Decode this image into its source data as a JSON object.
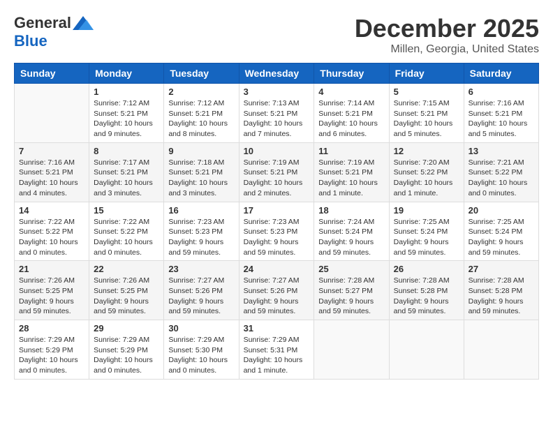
{
  "header": {
    "logo_general": "General",
    "logo_blue": "Blue",
    "month_title": "December 2025",
    "location": "Millen, Georgia, United States"
  },
  "weekdays": [
    "Sunday",
    "Monday",
    "Tuesday",
    "Wednesday",
    "Thursday",
    "Friday",
    "Saturday"
  ],
  "weeks": [
    [
      {
        "day": "",
        "info": ""
      },
      {
        "day": "1",
        "info": "Sunrise: 7:12 AM\nSunset: 5:21 PM\nDaylight: 10 hours\nand 9 minutes."
      },
      {
        "day": "2",
        "info": "Sunrise: 7:12 AM\nSunset: 5:21 PM\nDaylight: 10 hours\nand 8 minutes."
      },
      {
        "day": "3",
        "info": "Sunrise: 7:13 AM\nSunset: 5:21 PM\nDaylight: 10 hours\nand 7 minutes."
      },
      {
        "day": "4",
        "info": "Sunrise: 7:14 AM\nSunset: 5:21 PM\nDaylight: 10 hours\nand 6 minutes."
      },
      {
        "day": "5",
        "info": "Sunrise: 7:15 AM\nSunset: 5:21 PM\nDaylight: 10 hours\nand 5 minutes."
      },
      {
        "day": "6",
        "info": "Sunrise: 7:16 AM\nSunset: 5:21 PM\nDaylight: 10 hours\nand 5 minutes."
      }
    ],
    [
      {
        "day": "7",
        "info": "Sunrise: 7:16 AM\nSunset: 5:21 PM\nDaylight: 10 hours\nand 4 minutes."
      },
      {
        "day": "8",
        "info": "Sunrise: 7:17 AM\nSunset: 5:21 PM\nDaylight: 10 hours\nand 3 minutes."
      },
      {
        "day": "9",
        "info": "Sunrise: 7:18 AM\nSunset: 5:21 PM\nDaylight: 10 hours\nand 3 minutes."
      },
      {
        "day": "10",
        "info": "Sunrise: 7:19 AM\nSunset: 5:21 PM\nDaylight: 10 hours\nand 2 minutes."
      },
      {
        "day": "11",
        "info": "Sunrise: 7:19 AM\nSunset: 5:21 PM\nDaylight: 10 hours\nand 1 minute."
      },
      {
        "day": "12",
        "info": "Sunrise: 7:20 AM\nSunset: 5:22 PM\nDaylight: 10 hours\nand 1 minute."
      },
      {
        "day": "13",
        "info": "Sunrise: 7:21 AM\nSunset: 5:22 PM\nDaylight: 10 hours\nand 0 minutes."
      }
    ],
    [
      {
        "day": "14",
        "info": "Sunrise: 7:22 AM\nSunset: 5:22 PM\nDaylight: 10 hours\nand 0 minutes."
      },
      {
        "day": "15",
        "info": "Sunrise: 7:22 AM\nSunset: 5:22 PM\nDaylight: 10 hours\nand 0 minutes."
      },
      {
        "day": "16",
        "info": "Sunrise: 7:23 AM\nSunset: 5:23 PM\nDaylight: 9 hours\nand 59 minutes."
      },
      {
        "day": "17",
        "info": "Sunrise: 7:23 AM\nSunset: 5:23 PM\nDaylight: 9 hours\nand 59 minutes."
      },
      {
        "day": "18",
        "info": "Sunrise: 7:24 AM\nSunset: 5:24 PM\nDaylight: 9 hours\nand 59 minutes."
      },
      {
        "day": "19",
        "info": "Sunrise: 7:25 AM\nSunset: 5:24 PM\nDaylight: 9 hours\nand 59 minutes."
      },
      {
        "day": "20",
        "info": "Sunrise: 7:25 AM\nSunset: 5:24 PM\nDaylight: 9 hours\nand 59 minutes."
      }
    ],
    [
      {
        "day": "21",
        "info": "Sunrise: 7:26 AM\nSunset: 5:25 PM\nDaylight: 9 hours\nand 59 minutes."
      },
      {
        "day": "22",
        "info": "Sunrise: 7:26 AM\nSunset: 5:25 PM\nDaylight: 9 hours\nand 59 minutes."
      },
      {
        "day": "23",
        "info": "Sunrise: 7:27 AM\nSunset: 5:26 PM\nDaylight: 9 hours\nand 59 minutes."
      },
      {
        "day": "24",
        "info": "Sunrise: 7:27 AM\nSunset: 5:26 PM\nDaylight: 9 hours\nand 59 minutes."
      },
      {
        "day": "25",
        "info": "Sunrise: 7:28 AM\nSunset: 5:27 PM\nDaylight: 9 hours\nand 59 minutes."
      },
      {
        "day": "26",
        "info": "Sunrise: 7:28 AM\nSunset: 5:28 PM\nDaylight: 9 hours\nand 59 minutes."
      },
      {
        "day": "27",
        "info": "Sunrise: 7:28 AM\nSunset: 5:28 PM\nDaylight: 9 hours\nand 59 minutes."
      }
    ],
    [
      {
        "day": "28",
        "info": "Sunrise: 7:29 AM\nSunset: 5:29 PM\nDaylight: 10 hours\nand 0 minutes."
      },
      {
        "day": "29",
        "info": "Sunrise: 7:29 AM\nSunset: 5:29 PM\nDaylight: 10 hours\nand 0 minutes."
      },
      {
        "day": "30",
        "info": "Sunrise: 7:29 AM\nSunset: 5:30 PM\nDaylight: 10 hours\nand 0 minutes."
      },
      {
        "day": "31",
        "info": "Sunrise: 7:29 AM\nSunset: 5:31 PM\nDaylight: 10 hours\nand 1 minute."
      },
      {
        "day": "",
        "info": ""
      },
      {
        "day": "",
        "info": ""
      },
      {
        "day": "",
        "info": ""
      }
    ]
  ]
}
